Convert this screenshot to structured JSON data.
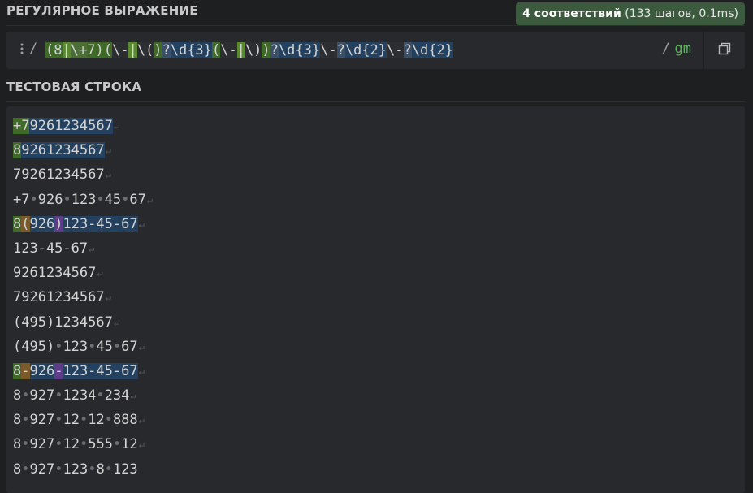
{
  "regex_section": {
    "title": "РЕГУЛЯРНОЕ ВЫРАЖЕНИЕ",
    "match_badge": {
      "count": "4 соответствий",
      "details": " (133 шагов, 0.1ms)"
    },
    "flags_menu_icon": "vertical-dots",
    "open_delimiter": "/",
    "close_delimiter": "/",
    "flags": "gm",
    "copy_icon": "copy-icon",
    "tokens": [
      {
        "t": "(",
        "color": "#d4d4d4",
        "bg": "#3f6a28"
      },
      {
        "t": "8",
        "color": "#d4d4d4",
        "bg": "#3f6a28"
      },
      {
        "t": "|",
        "color": "#d4d4d4",
        "bg": "#5a8a30"
      },
      {
        "t": "\\+",
        "color": "#d4d4d4",
        "bg": "#4a6e36"
      },
      {
        "t": "7",
        "color": "#d4d4d4",
        "bg": "#3f6a28"
      },
      {
        "t": ")",
        "color": "#d4d4d4",
        "bg": "#3f6a28"
      },
      {
        "t": "(",
        "color": "#d4d4d4",
        "bg": "#3f6a28"
      },
      {
        "t": "\\-",
        "color": "#d4d4d4",
        "bg": "#2c2e31"
      },
      {
        "t": "|",
        "color": "#d4d4d4",
        "bg": "#5a8a30"
      },
      {
        "t": "\\(",
        "color": "#d4d4d4",
        "bg": "#2c2e31"
      },
      {
        "t": ")",
        "color": "#d4d4d4",
        "bg": "#3f6a28"
      },
      {
        "t": "?",
        "color": "#d4d4d4",
        "bg": "#3b4f66"
      },
      {
        "t": "\\d",
        "color": "#d4d4d4",
        "bg": "#24425f"
      },
      {
        "t": "{3}",
        "color": "#d4d4d4",
        "bg": "#24425f"
      },
      {
        "t": "(",
        "color": "#d4d4d4",
        "bg": "#3f6a28"
      },
      {
        "t": "\\-",
        "color": "#d4d4d4",
        "bg": "#2c2e31"
      },
      {
        "t": "|",
        "color": "#d4d4d4",
        "bg": "#5a8a30"
      },
      {
        "t": "\\)",
        "color": "#d4d4d4",
        "bg": "#2c2e31"
      },
      {
        "t": ")",
        "color": "#d4d4d4",
        "bg": "#3f6a28"
      },
      {
        "t": "?",
        "color": "#d4d4d4",
        "bg": "#3b4f66"
      },
      {
        "t": "\\d",
        "color": "#d4d4d4",
        "bg": "#24425f"
      },
      {
        "t": "{3}",
        "color": "#d4d4d4",
        "bg": "#24425f"
      },
      {
        "t": "\\-",
        "color": "#d4d4d4",
        "bg": "#2c2e31"
      },
      {
        "t": "?",
        "color": "#d4d4d4",
        "bg": "#3b4f66"
      },
      {
        "t": "\\d",
        "color": "#d4d4d4",
        "bg": "#24425f"
      },
      {
        "t": "{2}",
        "color": "#d4d4d4",
        "bg": "#24425f"
      },
      {
        "t": "\\-",
        "color": "#d4d4d4",
        "bg": "#2c2e31"
      },
      {
        "t": "?",
        "color": "#d4d4d4",
        "bg": "#3b4f66"
      },
      {
        "t": "\\d",
        "color": "#d4d4d4",
        "bg": "#24425f"
      },
      {
        "t": "{2}",
        "color": "#d4d4d4",
        "bg": "#24425f"
      }
    ]
  },
  "test_section": {
    "title": "ТЕСТОВАЯ СТРОКА",
    "eol_symbol": "↵",
    "space_symbol": "•",
    "colors": {
      "group": "#3f6a28",
      "match": "#24425f",
      "group2": "#5e3c8a",
      "orange": "#7a5a2a"
    },
    "lines": [
      {
        "segs": [
          {
            "t": "+7",
            "bg": "#3f6a28"
          },
          {
            "t": "9261234567",
            "bg": "#24425f"
          }
        ],
        "eol": true
      },
      {
        "segs": [
          {
            "t": "8",
            "bg": "#3f6a28"
          },
          {
            "t": "9261234567",
            "bg": "#24425f"
          }
        ],
        "eol": true
      },
      {
        "segs": [
          {
            "t": "79261234567"
          }
        ],
        "eol": true
      },
      {
        "segs": [
          {
            "t": "+7 926 123 45 67"
          }
        ],
        "eol": true
      },
      {
        "segs": [
          {
            "t": "8",
            "bg": "#3f6a28"
          },
          {
            "t": "(",
            "bg": "#7a5a2a"
          },
          {
            "t": "926",
            "bg": "#24425f"
          },
          {
            "t": ")",
            "bg": "#5e3c8a"
          },
          {
            "t": "123-45-67",
            "bg": "#24425f"
          }
        ],
        "eol": true
      },
      {
        "segs": [
          {
            "t": "123-45-67"
          }
        ],
        "eol": true
      },
      {
        "segs": [
          {
            "t": "9261234567"
          }
        ],
        "eol": true
      },
      {
        "segs": [
          {
            "t": "79261234567"
          }
        ],
        "eol": true
      },
      {
        "segs": [
          {
            "t": "(495)1234567"
          }
        ],
        "eol": true
      },
      {
        "segs": [
          {
            "t": "(495) 123 45 67"
          }
        ],
        "eol": true
      },
      {
        "segs": [
          {
            "t": "8",
            "bg": "#3f6a28"
          },
          {
            "t": "-",
            "bg": "#7a5a2a"
          },
          {
            "t": "926",
            "bg": "#24425f"
          },
          {
            "t": "-",
            "bg": "#5e3c8a"
          },
          {
            "t": "123-45-67",
            "bg": "#24425f"
          }
        ],
        "eol": true
      },
      {
        "segs": [
          {
            "t": "8 927 1234 234"
          }
        ],
        "eol": true
      },
      {
        "segs": [
          {
            "t": "8 927 12 12 888"
          }
        ],
        "eol": true
      },
      {
        "segs": [
          {
            "t": "8 927 12 555 12"
          }
        ],
        "eol": true
      },
      {
        "segs": [
          {
            "t": "8 927 123 8 123"
          }
        ],
        "eol": false
      }
    ]
  }
}
